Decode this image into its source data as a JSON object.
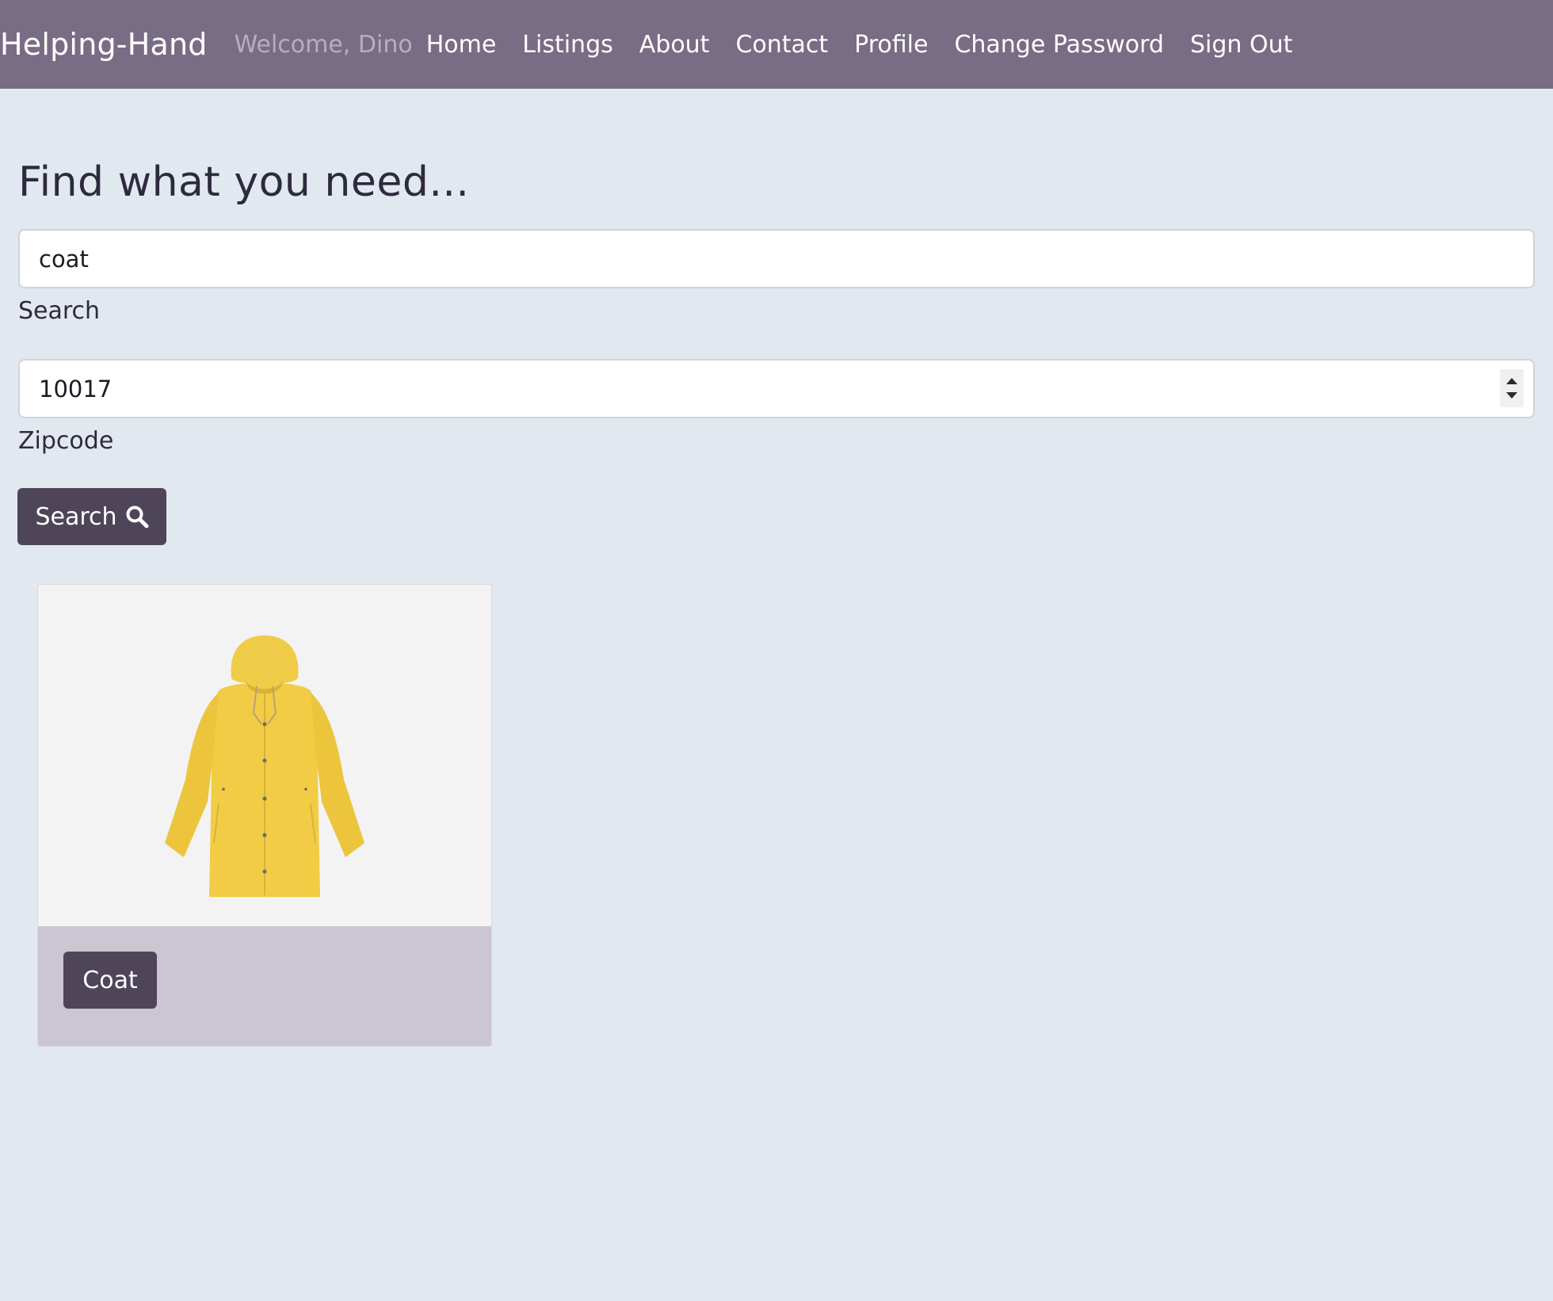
{
  "navbar": {
    "brand": "Helping-Hand",
    "welcome": "Welcome, Dino",
    "links": [
      "Home",
      "Listings",
      "About",
      "Contact",
      "Profile",
      "Change Password",
      "Sign Out"
    ],
    "background_color": "#796c85"
  },
  "main": {
    "heading": "Find what you need...",
    "search": {
      "value": "coat",
      "label": "Search"
    },
    "zipcode": {
      "value": "10017",
      "label": "Zipcode"
    },
    "search_button": {
      "label": "Search",
      "icon": "search-icon"
    }
  },
  "results": [
    {
      "title": "Coat",
      "image": "yellow-raincoat-image"
    }
  ],
  "colors": {
    "page_background": "#e2e8f0",
    "button": "#4e4559",
    "card_footer": "#ccc5d2"
  }
}
